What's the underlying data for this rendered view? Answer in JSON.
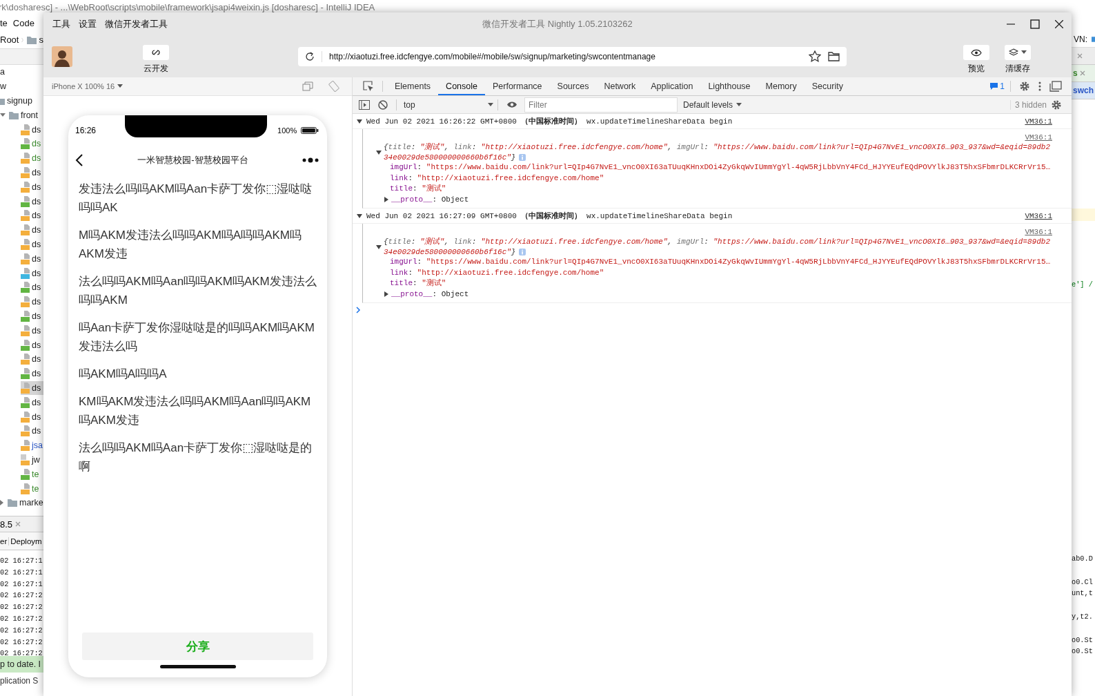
{
  "ide": {
    "title": "rk\\dosharesc] - ...\\WebRoot\\scripts\\mobile\\framework\\jsapi4weixin.js [dosharesc] - IntelliJ IDEA",
    "menu": [
      "te",
      "Code"
    ],
    "breadcrumb": [
      "Root",
      "s"
    ],
    "tree": [
      {
        "label": "a",
        "kind": "text"
      },
      {
        "label": "w",
        "kind": "text"
      },
      {
        "label": "signup",
        "kind": "folder",
        "children": [
          {
            "label": "front",
            "kind": "folder",
            "expanded": true,
            "children": [
              {
                "label": "ds",
                "kind": "js",
                "color": "#1e1e1e",
                "selected": false
              },
              {
                "label": "ds",
                "kind": "html",
                "color": "#3a8a2c",
                "selected": false
              },
              {
                "label": "ds",
                "kind": "js",
                "color": "#3a8a2c",
                "selected": false
              },
              {
                "label": "ds",
                "kind": "js",
                "color": "#1e1e1e",
                "selected": false
              },
              {
                "label": "ds",
                "kind": "js",
                "color": "#1e1e1e",
                "selected": false
              },
              {
                "label": "ds",
                "kind": "html",
                "color": "#1e1e1e",
                "selected": false
              },
              {
                "label": "ds",
                "kind": "js",
                "color": "#1e1e1e",
                "selected": false
              },
              {
                "label": "ds",
                "kind": "js",
                "color": "#1e1e1e",
                "selected": false
              },
              {
                "label": "ds",
                "kind": "js",
                "color": "#1e1e1e",
                "selected": false
              },
              {
                "label": "ds",
                "kind": "js",
                "color": "#1e1e1e",
                "selected": false
              },
              {
                "label": "ds",
                "kind": "css",
                "color": "#1e1e1e",
                "selected": false
              },
              {
                "label": "ds",
                "kind": "html",
                "color": "#1e1e1e",
                "selected": false
              },
              {
                "label": "ds",
                "kind": "js",
                "color": "#1e1e1e",
                "selected": false
              },
              {
                "label": "ds",
                "kind": "html",
                "color": "#1e1e1e",
                "selected": false
              },
              {
                "label": "ds",
                "kind": "js",
                "color": "#1e1e1e",
                "selected": false
              },
              {
                "label": "ds",
                "kind": "html",
                "color": "#1e1e1e",
                "selected": false
              },
              {
                "label": "ds",
                "kind": "js",
                "color": "#1e1e1e",
                "selected": false
              },
              {
                "label": "ds",
                "kind": "html",
                "color": "#1e1e1e",
                "selected": false
              },
              {
                "label": "ds",
                "kind": "js",
                "color": "#1e1e1e",
                "selected": true
              },
              {
                "label": "ds",
                "kind": "html",
                "color": "#1e1e1e",
                "selected": false
              },
              {
                "label": "ds",
                "kind": "js",
                "color": "#1e1e1e",
                "selected": false
              },
              {
                "label": "ds",
                "kind": "js",
                "color": "#1e1e1e",
                "selected": false
              },
              {
                "label": "jsa",
                "kind": "js",
                "color": "#2a56c6",
                "selected": false
              },
              {
                "label": "jw",
                "kind": "binary",
                "color": "#1e1e1e",
                "selected": false
              },
              {
                "label": "te",
                "kind": "html",
                "color": "#3a8a2c",
                "selected": false
              },
              {
                "label": "te",
                "kind": "js",
                "color": "#3a8a2c",
                "selected": false
              }
            ]
          },
          {
            "label": "marke",
            "kind": "folder",
            "expanded": false
          }
        ]
      }
    ],
    "bottom_panel": {
      "tab": "8.5",
      "toolbar": [
        "er",
        "Deploym"
      ],
      "log": [
        "02 16:27:1",
        "02 16:27:1",
        "02 16:27:1",
        "02 16:27:2",
        "02 16:27:2",
        "02 16:27:2",
        "02 16:27:2",
        "02 16:27:2",
        "02 16:27:2"
      ],
      "status": "p to date. I",
      "footer": "plication S"
    },
    "right_edge": {
      "toolbar_label": "VN:",
      "tabs": [
        {
          "label": "s",
          "closable": true,
          "selected": false,
          "color": "#3a8a2c"
        },
        {
          "label": "swch",
          "closable": false,
          "selected": true,
          "color": "#2a56c6"
        }
      ],
      "code": "e'] /",
      "log_groups": [
        [
          "ab0.D"
        ],
        [
          "o0.Cl",
          "unt,t"
        ],
        [
          "y,t2."
        ],
        [
          "o0.St",
          "o0.St"
        ]
      ]
    }
  },
  "devtools_window": {
    "menu": [
      "工具",
      "设置",
      "微信开发者工具"
    ],
    "title": "微信开发者工具 Nightly 1.05.2103262",
    "toolbar": {
      "cloud_label": "云开发",
      "url": "http://xiaotuzi.free.idcfengye.com/mobile#/mobile/sw/signup/marketing/swcontentmanage",
      "buttons": [
        {
          "label": "预览",
          "kind": "eye"
        },
        {
          "label": "清缓存",
          "kind": "layers"
        }
      ]
    },
    "simulator": {
      "device": "iPhone X 100% 16",
      "time": "16:26",
      "battery": "100%",
      "nav_title": "一米智慧校园-智慧校园平台",
      "paragraphs": [
        "发违法么吗吗AKM吗Aan卡萨丁发你⬚湿哒哒吗吗AK",
        "M吗AKM发违法么吗吗AKM吗A吗吗AKM吗AKM发违",
        "法么吗吗AKM吗Aan吗吗AKM吗AKM发违法么吗吗AKM",
        "吗Aan卡萨丁发你湿哒哒是的吗吗AKM吗AKM发违法么吗",
        "吗AKM吗A吗吗A",
        "KM吗AKM发违法么吗吗AKM吗Aan吗吗AKM吗AKM发违",
        "法么吗吗AKM吗Aan卡萨丁发你⬚湿哒哒是的啊"
      ],
      "share_button": "分享"
    },
    "devtools": {
      "tabs": [
        {
          "label": "Elements",
          "selected": false
        },
        {
          "label": "Console",
          "selected": true
        },
        {
          "label": "Performance",
          "selected": false
        },
        {
          "label": "Sources",
          "selected": false
        },
        {
          "label": "Network",
          "selected": false
        },
        {
          "label": "Application",
          "selected": false
        },
        {
          "label": "Lighthouse",
          "selected": false
        },
        {
          "label": "Memory",
          "selected": false
        },
        {
          "label": "Security",
          "selected": false
        }
      ],
      "message_count": "1",
      "context": "top",
      "filter_placeholder": "Filter",
      "levels": "Default levels",
      "hidden": "3 hidden",
      "entries": [
        {
          "header": "Wed Jun 02 2021 16:26:22 GMT+0800 **（中国标准时间）** wx.updateTimelineShareData begin",
          "source": "VM36:1",
          "summary_source": "VM36:1",
          "summary": [
            [
              {
                "kind": "punct",
                "text": "{"
              },
              {
                "kind": "key",
                "text": "title"
              },
              {
                "kind": "punct",
                "text": ": "
              },
              {
                "kind": "string",
                "text": "\"测试\""
              },
              {
                "kind": "punct",
                "text": ", "
              },
              {
                "kind": "key",
                "text": "link"
              },
              {
                "kind": "punct",
                "text": ": "
              },
              {
                "kind": "string",
                "text": "\"http://xiaotuzi.free.idcfengye.com/home\""
              },
              {
                "kind": "punct",
                "text": ", "
              },
              {
                "kind": "key",
                "text": "imgUrl"
              },
              {
                "kind": "punct",
                "text": ": "
              },
              {
                "kind": "string",
                "text": "\"https://www.baidu.com/link?url=QIp4G7NvE1_vncO0XI6…903_937&wd=&eqid=89db2"
              }
            ],
            [
              {
                "kind": "string",
                "text": "34e0029de580000000660b6f16c\""
              },
              {
                "kind": "punct",
                "text": "}"
              }
            ]
          ],
          "properties": [
            {
              "key": "imgUrl",
              "sep": ": ",
              "value": "\"https://www.baidu.com/link?url=QIp4G7NvE1_vncO0XI63aTUuqKHnxDOi4ZyGkqWvIUmmYgYl-4qW5RjLbbVnY4FCd_HJYYEufEQdPOVYlkJ83T5hxSFbmrDLKCRrVr15…"
            },
            {
              "key": "link",
              "sep": ": ",
              "value": "\"http://xiaotuzi.free.idcfengye.com/home\""
            },
            {
              "key": "title",
              "sep": ": ",
              "value": "\"测试\""
            }
          ],
          "proto": {
            "key": "__proto__",
            "sep": ": ",
            "value": "Object"
          }
        },
        {
          "header": "Wed Jun 02 2021 16:27:09 GMT+0800 **（中国标准时间）** wx.updateTimelineShareData begin",
          "source": "VM36:1",
          "summary_source": "VM36:1",
          "summary": [
            [
              {
                "kind": "punct",
                "text": "{"
              },
              {
                "kind": "key",
                "text": "title"
              },
              {
                "kind": "punct",
                "text": ": "
              },
              {
                "kind": "string",
                "text": "\"测试\""
              },
              {
                "kind": "punct",
                "text": ", "
              },
              {
                "kind": "key",
                "text": "link"
              },
              {
                "kind": "punct",
                "text": ": "
              },
              {
                "kind": "string",
                "text": "\"http://xiaotuzi.free.idcfengye.com/home\""
              },
              {
                "kind": "punct",
                "text": ", "
              },
              {
                "kind": "key",
                "text": "imgUrl"
              },
              {
                "kind": "punct",
                "text": ": "
              },
              {
                "kind": "string",
                "text": "\"https://www.baidu.com/link?url=QIp4G7NvE1_vncO0XI6…903_937&wd=&eqid=89db2"
              }
            ],
            [
              {
                "kind": "string",
                "text": "34e0029de580000000660b6f16c\""
              },
              {
                "kind": "punct",
                "text": "}"
              }
            ]
          ],
          "properties": [
            {
              "key": "imgUrl",
              "sep": ": ",
              "value": "\"https://www.baidu.com/link?url=QIp4G7NvE1_vncO0XI63aTUuqKHnxDOi4ZyGkqWvIUmmYgYl-4qW5RjLbbVnY4FCd_HJYYEufEQdPOVYlkJ83T5hxSFbmrDLKCRrVr15…"
            },
            {
              "key": "link",
              "sep": ": ",
              "value": "\"http://xiaotuzi.free.idcfengye.com/home\""
            },
            {
              "key": "title",
              "sep": ": ",
              "value": "\"测试\""
            }
          ],
          "proto": {
            "key": "__proto__",
            "sep": ": ",
            "value": "Object"
          }
        }
      ]
    }
  }
}
